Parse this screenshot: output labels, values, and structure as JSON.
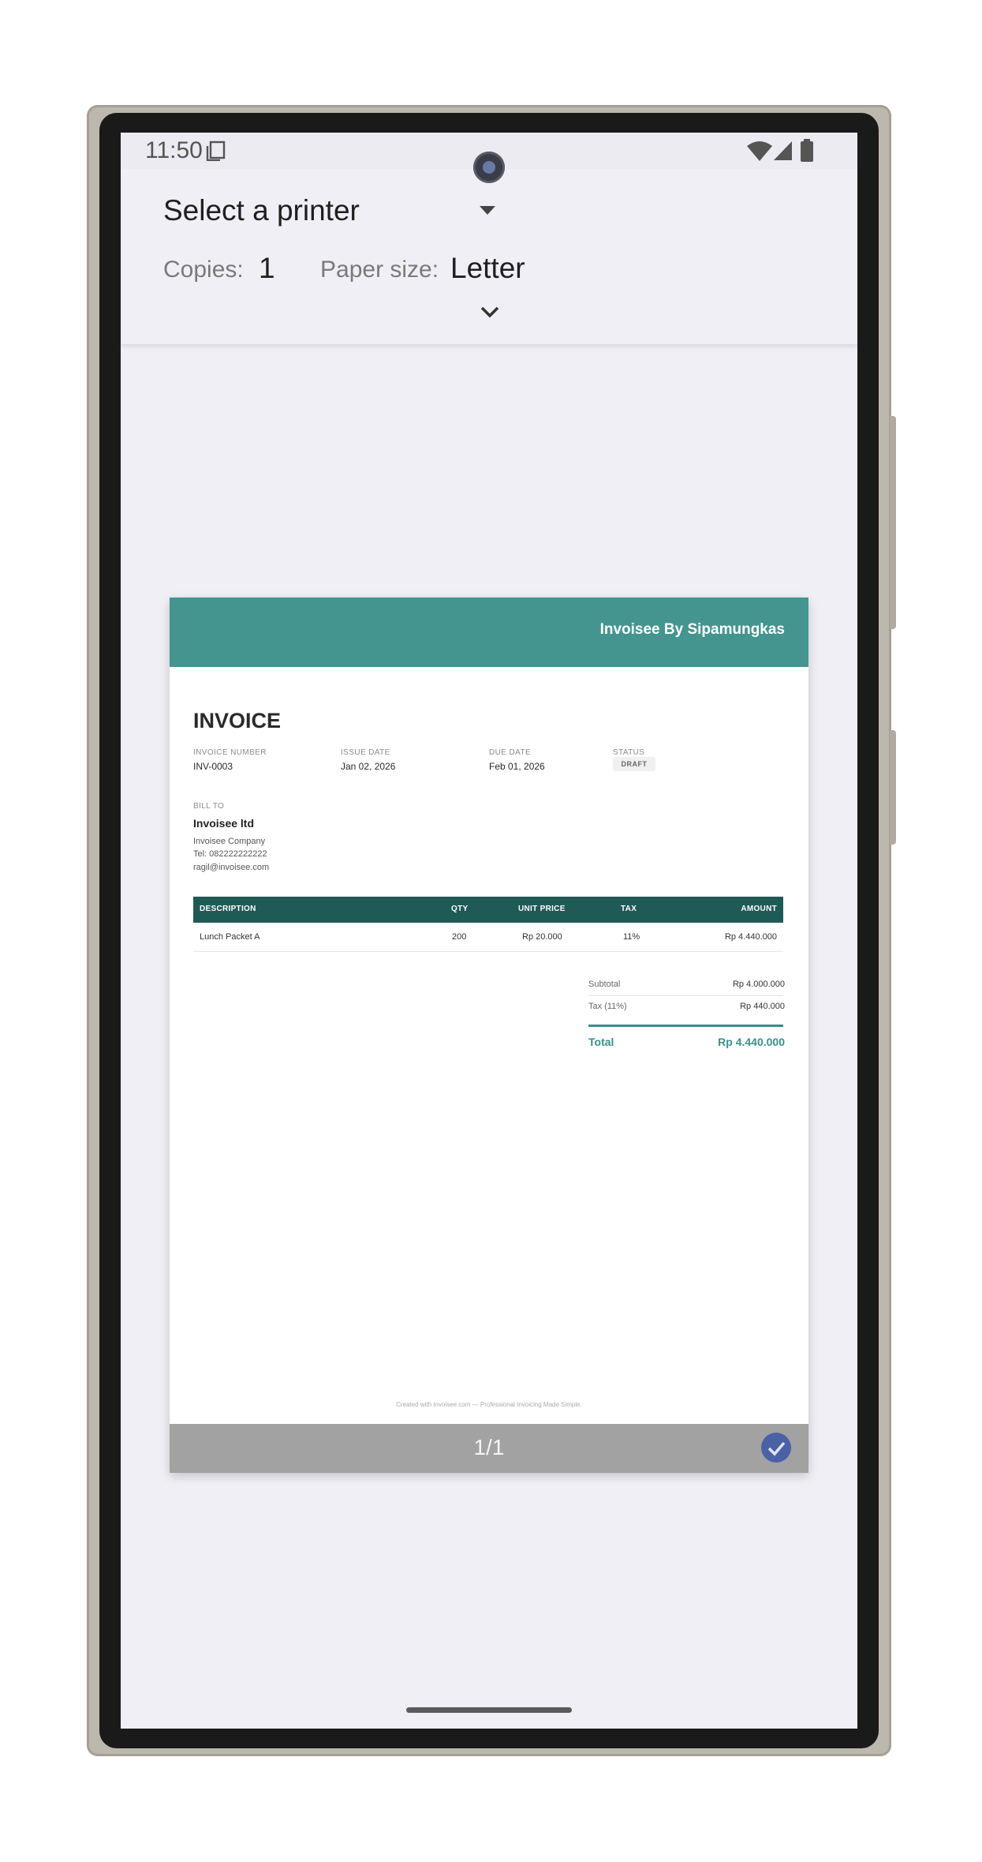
{
  "status_bar": {
    "time": "11:50"
  },
  "print_header": {
    "printer_label": "Select a printer",
    "copies_label": "Copies:",
    "copies_value": "1",
    "paper_size_label": "Paper size:",
    "paper_size_value": "Letter"
  },
  "invoice": {
    "brand": "Invoisee By Sipamungkas",
    "title": "INVOICE",
    "meta": {
      "invoice_number_label": "INVOICE NUMBER",
      "invoice_number": "INV-0003",
      "issue_date_label": "ISSUE DATE",
      "issue_date": "Jan 02, 2026",
      "due_date_label": "DUE DATE",
      "due_date": "Feb 01, 2026",
      "status_label": "STATUS",
      "status": "DRAFT"
    },
    "bill_to": {
      "label": "BILL TO",
      "name": "Invoisee ltd",
      "company": "Invoisee Company",
      "tel": "Tel: 082222222222",
      "email": "ragil@invoisee.com"
    },
    "table": {
      "headers": [
        "DESCRIPTION",
        "QTY",
        "UNIT PRICE",
        "TAX",
        "AMOUNT"
      ],
      "rows": [
        [
          "Lunch Packet A",
          "200",
          "Rp 20.000",
          "11%",
          "Rp 4.440.000"
        ]
      ]
    },
    "summary": {
      "subtotal_label": "Subtotal",
      "subtotal": "Rp 4.000.000",
      "tax_label": "Tax (11%)",
      "tax": "Rp 440.000",
      "total_label": "Total",
      "total": "Rp 4.440.000"
    },
    "footer": "Created with Invoisee.com — Professional Invoicing Made Simple."
  },
  "preview": {
    "page_indicator": "1/1"
  },
  "colors": {
    "header": "#449590",
    "table_header": "#205a56",
    "accent": "#3a8f89",
    "check": "#4a61a6"
  }
}
